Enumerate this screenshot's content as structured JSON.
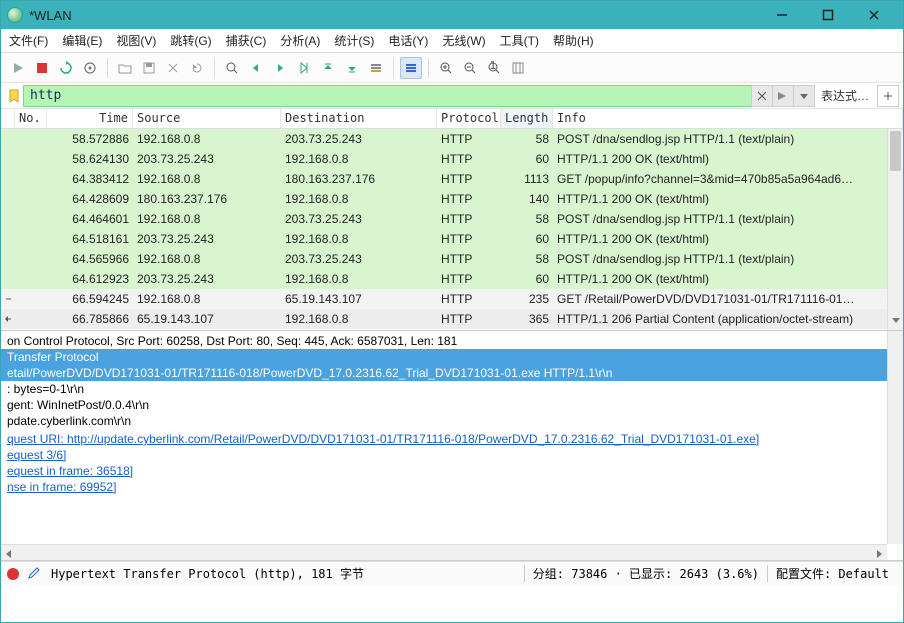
{
  "window": {
    "title": "*WLAN"
  },
  "menu": [
    "文件(F)",
    "编辑(E)",
    "视图(V)",
    "跳转(G)",
    "捕获(C)",
    "分析(A)",
    "统计(S)",
    "电话(Y)",
    "无线(W)",
    "工具(T)",
    "帮助(H)"
  ],
  "filter": {
    "value": "http",
    "expression_label": "表达式…"
  },
  "columns": {
    "no": "No.",
    "time": "Time",
    "source": "Source",
    "destination": "Destination",
    "protocol": "Protocol",
    "length": "Length",
    "info": "Info"
  },
  "packets": [
    {
      "arrow": "",
      "no": "",
      "time": "58.572886",
      "src": "192.168.0.8",
      "dst": "203.73.25.243",
      "proto": "HTTP",
      "len": "58",
      "info": "POST /dna/sendlog.jsp HTTP/1.1  (text/plain)",
      "cls": "green"
    },
    {
      "arrow": "",
      "no": "",
      "time": "58.624130",
      "src": "203.73.25.243",
      "dst": "192.168.0.8",
      "proto": "HTTP",
      "len": "60",
      "info": "HTTP/1.1 200 OK  (text/html)",
      "cls": "green"
    },
    {
      "arrow": "",
      "no": "",
      "time": "64.383412",
      "src": "192.168.0.8",
      "dst": "180.163.237.176",
      "proto": "HTTP",
      "len": "1113",
      "info": "GET /popup/info?channel=3&mid=470b85a5a964ad6…",
      "cls": "green"
    },
    {
      "arrow": "",
      "no": "",
      "time": "64.428609",
      "src": "180.163.237.176",
      "dst": "192.168.0.8",
      "proto": "HTTP",
      "len": "140",
      "info": "HTTP/1.1 200 OK  (text/html)",
      "cls": "green"
    },
    {
      "arrow": "",
      "no": "",
      "time": "64.464601",
      "src": "192.168.0.8",
      "dst": "203.73.25.243",
      "proto": "HTTP",
      "len": "58",
      "info": "POST /dna/sendlog.jsp HTTP/1.1  (text/plain)",
      "cls": "green"
    },
    {
      "arrow": "",
      "no": "",
      "time": "64.518161",
      "src": "203.73.25.243",
      "dst": "192.168.0.8",
      "proto": "HTTP",
      "len": "60",
      "info": "HTTP/1.1 200 OK  (text/html)",
      "cls": "green"
    },
    {
      "arrow": "",
      "no": "",
      "time": "64.565966",
      "src": "192.168.0.8",
      "dst": "203.73.25.243",
      "proto": "HTTP",
      "len": "58",
      "info": "POST /dna/sendlog.jsp HTTP/1.1  (text/plain)",
      "cls": "green"
    },
    {
      "arrow": "",
      "no": "",
      "time": "64.612923",
      "src": "203.73.25.243",
      "dst": "192.168.0.8",
      "proto": "HTTP",
      "len": "60",
      "info": "HTTP/1.1 200 OK  (text/html)",
      "cls": "green"
    },
    {
      "arrow": "out",
      "no": "",
      "time": "66.594245",
      "src": "192.168.0.8",
      "dst": "65.19.143.107",
      "proto": "HTTP",
      "len": "235",
      "info": "GET /Retail/PowerDVD/DVD171031-01/TR171116-01…",
      "cls": "sel"
    },
    {
      "arrow": "in",
      "no": "",
      "time": "66.785866",
      "src": "65.19.143.107",
      "dst": "192.168.0.8",
      "proto": "HTTP",
      "len": "365",
      "info": "HTTP/1.1 206 Partial Content  (application/octet-stream)",
      "cls": "grey"
    }
  ],
  "details": {
    "l1": "on Control Protocol, Src Port: 60258, Dst Port: 80, Seq: 445, Ack: 6587031, Len: 181",
    "l2": "Transfer Protocol",
    "l3": "etail/PowerDVD/DVD171031-01/TR171116-018/PowerDVD_17.0.2316.62_Trial_DVD171031-01.exe HTTP/1.1\\r\\n",
    "l4": ": bytes=0-1\\r\\n",
    "l5": "gent: WinInetPost/0.0.4\\r\\n",
    "l6": "pdate.cyberlink.com\\r\\n",
    "l7": "",
    "l8": "quest URI: http://update.cyberlink.com/Retail/PowerDVD/DVD171031-01/TR171116-018/PowerDVD_17.0.2316.62_Trial_DVD171031-01.exe]",
    "l9": "equest 3/6]",
    "l10": "equest in frame: 36518]",
    "l11": "nse in frame: 69952]"
  },
  "status": {
    "main": "Hypertext Transfer Protocol (http), 181 字节",
    "seg1": "分组: 73846 · 已显示: 2643 (3.6%)",
    "seg2": "配置文件: Default"
  }
}
